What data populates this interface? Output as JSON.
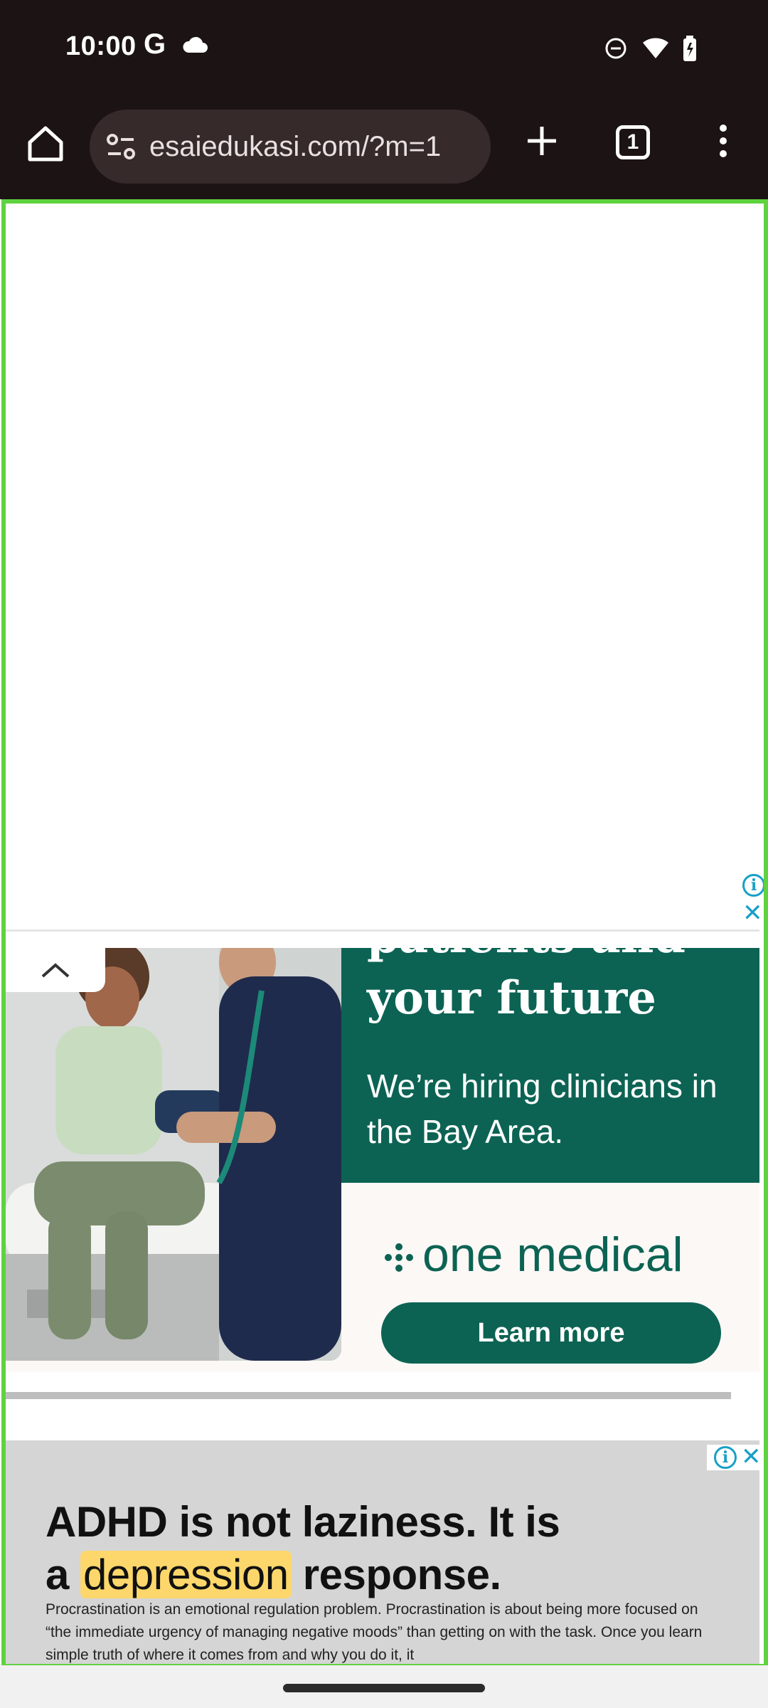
{
  "status_bar": {
    "time": "10:00",
    "g_badge": "G",
    "icons": [
      "cloud-icon",
      "do-not-disturb-icon",
      "wifi-icon",
      "battery-icon"
    ]
  },
  "toolbar": {
    "url": "esaiedukasi.com/?m=1",
    "tab_count": "1",
    "icons": [
      "home-icon",
      "site-settings-icon",
      "plus-icon",
      "tab-switcher-icon",
      "more-vert-icon"
    ]
  },
  "anchor_ad": {
    "headline_top": "patients and",
    "headline_bottom": "your future",
    "subtext": "We’re hiring clinicians in the Bay Area.",
    "brand": "one medical",
    "cta": "Learn more",
    "colors": {
      "brand_green": "#0c6353",
      "cream": "#fbf8f5"
    }
  },
  "promo_ad": {
    "title_line1": "ADHD is not laziness. It is",
    "title_a": "a",
    "title_highlight": "depression",
    "title_end": "response.",
    "body": "Procrastination is an emotional regulation problem. Procrastination is about being more focused on “the immediate urgency of managing negative moods” than getting on with the task. Once you learn simple truth of where it comes from and why you do it, it",
    "highlight_color": "#fdd76b"
  },
  "adchoices": {
    "info": "i",
    "close": "✕"
  },
  "frame_color": "#5fd23f"
}
